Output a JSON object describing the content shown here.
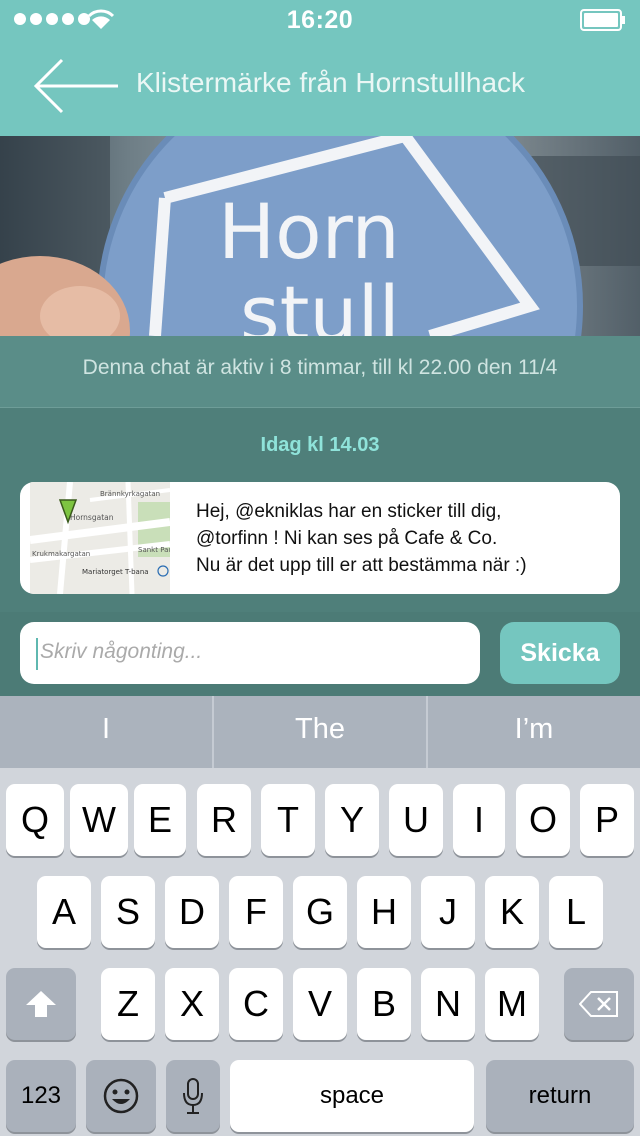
{
  "status": {
    "time": "16:20"
  },
  "nav": {
    "title": "Klistermärke från Hornstullhack"
  },
  "photo": {
    "sticker_line1": "Horn",
    "sticker_line2": "stull"
  },
  "banner": {
    "text": "Denna chat är aktiv i 8 timmar, till kl 22.00 den 11/4"
  },
  "chat": {
    "timestamp": "Idag kl 14.03",
    "message_line1": "Hej, @ekniklas har en sticker till dig,",
    "message_line2": "@torfinn ! Ni kan ses på Cafe & Co.",
    "message_line3": "Nu är det upp till er att bestämma när :)",
    "map": {
      "street1": "Brännkyrkagatan",
      "street2": "Hornsgatan",
      "street3": "Krukmakargatan",
      "street4": "Sankt Pau",
      "station": "Mariatorget T-bana"
    }
  },
  "input": {
    "placeholder": "Skriv någonting...",
    "send_label": "Skicka"
  },
  "keyboard": {
    "suggestions": [
      "I",
      "The",
      "I’m"
    ],
    "row1": [
      "Q",
      "W",
      "E",
      "R",
      "T",
      "Y",
      "U",
      "I",
      "O",
      "P"
    ],
    "row2": [
      "A",
      "S",
      "D",
      "F",
      "G",
      "H",
      "J",
      "K",
      "L"
    ],
    "row3": [
      "Z",
      "X",
      "C",
      "V",
      "B",
      "N",
      "M"
    ],
    "numbers_label": "123",
    "space_label": "space",
    "return_label": "return"
  },
  "colors": {
    "accent": "#75c6bf",
    "chat_bg": "#4f7f7a",
    "timestamp": "#8fe3da"
  }
}
